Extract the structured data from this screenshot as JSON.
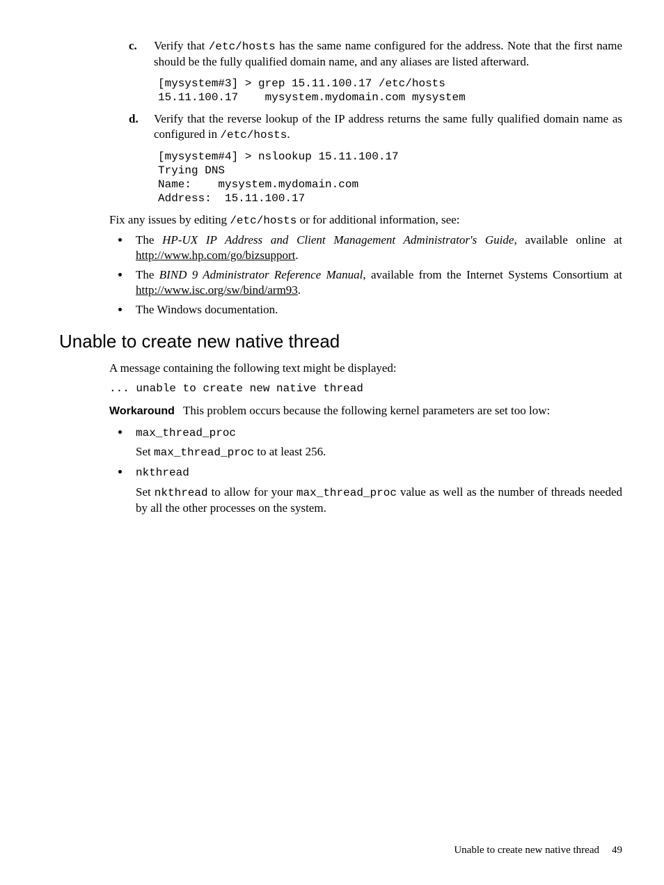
{
  "steps": {
    "c": {
      "marker": "c.",
      "text_parts": [
        "Verify that ",
        "/etc/hosts",
        " has the same name configured for the address. Note that the first name should be the fully qualified domain name, and any aliases are listed afterward."
      ],
      "code": "[mysystem#3] > grep 15.11.100.17 /etc/hosts\n15.11.100.17    mysystem.mydomain.com mysystem"
    },
    "d": {
      "marker": "d.",
      "text_parts": [
        "Verify that the reverse lookup of the IP address returns the same fully qualified domain name as configured in ",
        "/etc/hosts",
        "."
      ],
      "code": "[mysystem#4] > nslookup 15.11.100.17\nTrying DNS\nName:    mysystem.mydomain.com\nAddress:  15.11.100.17"
    }
  },
  "fix_line": {
    "parts": [
      "Fix any issues by editing ",
      "/etc/hosts",
      " or for additional information, see:"
    ]
  },
  "see_list": [
    {
      "pre": "The ",
      "italic": "HP-UX IP Address and Client Management Administrator's Guide",
      "mid": ", available online at ",
      "link": "http://www.hp.com/go/bizsupport",
      "post": "."
    },
    {
      "pre": "The ",
      "italic": "BIND 9 Administrator Reference Manual",
      "mid": ", available from the Internet Systems Consortium at ",
      "link": "http://www.isc.org/sw/bind/arm93",
      "post": "."
    },
    {
      "plain": "The Windows documentation."
    }
  ],
  "section": {
    "heading": "Unable to create new native thread",
    "intro": "A message containing the following text might be displayed:",
    "message": "... unable to create new native thread",
    "workaround_label": "Workaround",
    "workaround_text": "This problem occurs because the following kernel parameters are set too low:",
    "params": [
      {
        "name": "max_thread_proc",
        "desc_parts": [
          "Set ",
          "max_thread_proc",
          " to at least 256."
        ]
      },
      {
        "name": "nkthread",
        "desc_parts": [
          "Set ",
          "nkthread",
          " to allow for your ",
          "max_thread_proc",
          " value as well as the number of threads needed by all the other processes on the system."
        ]
      }
    ]
  },
  "footer": {
    "title": "Unable to create new native thread",
    "page": "49"
  }
}
